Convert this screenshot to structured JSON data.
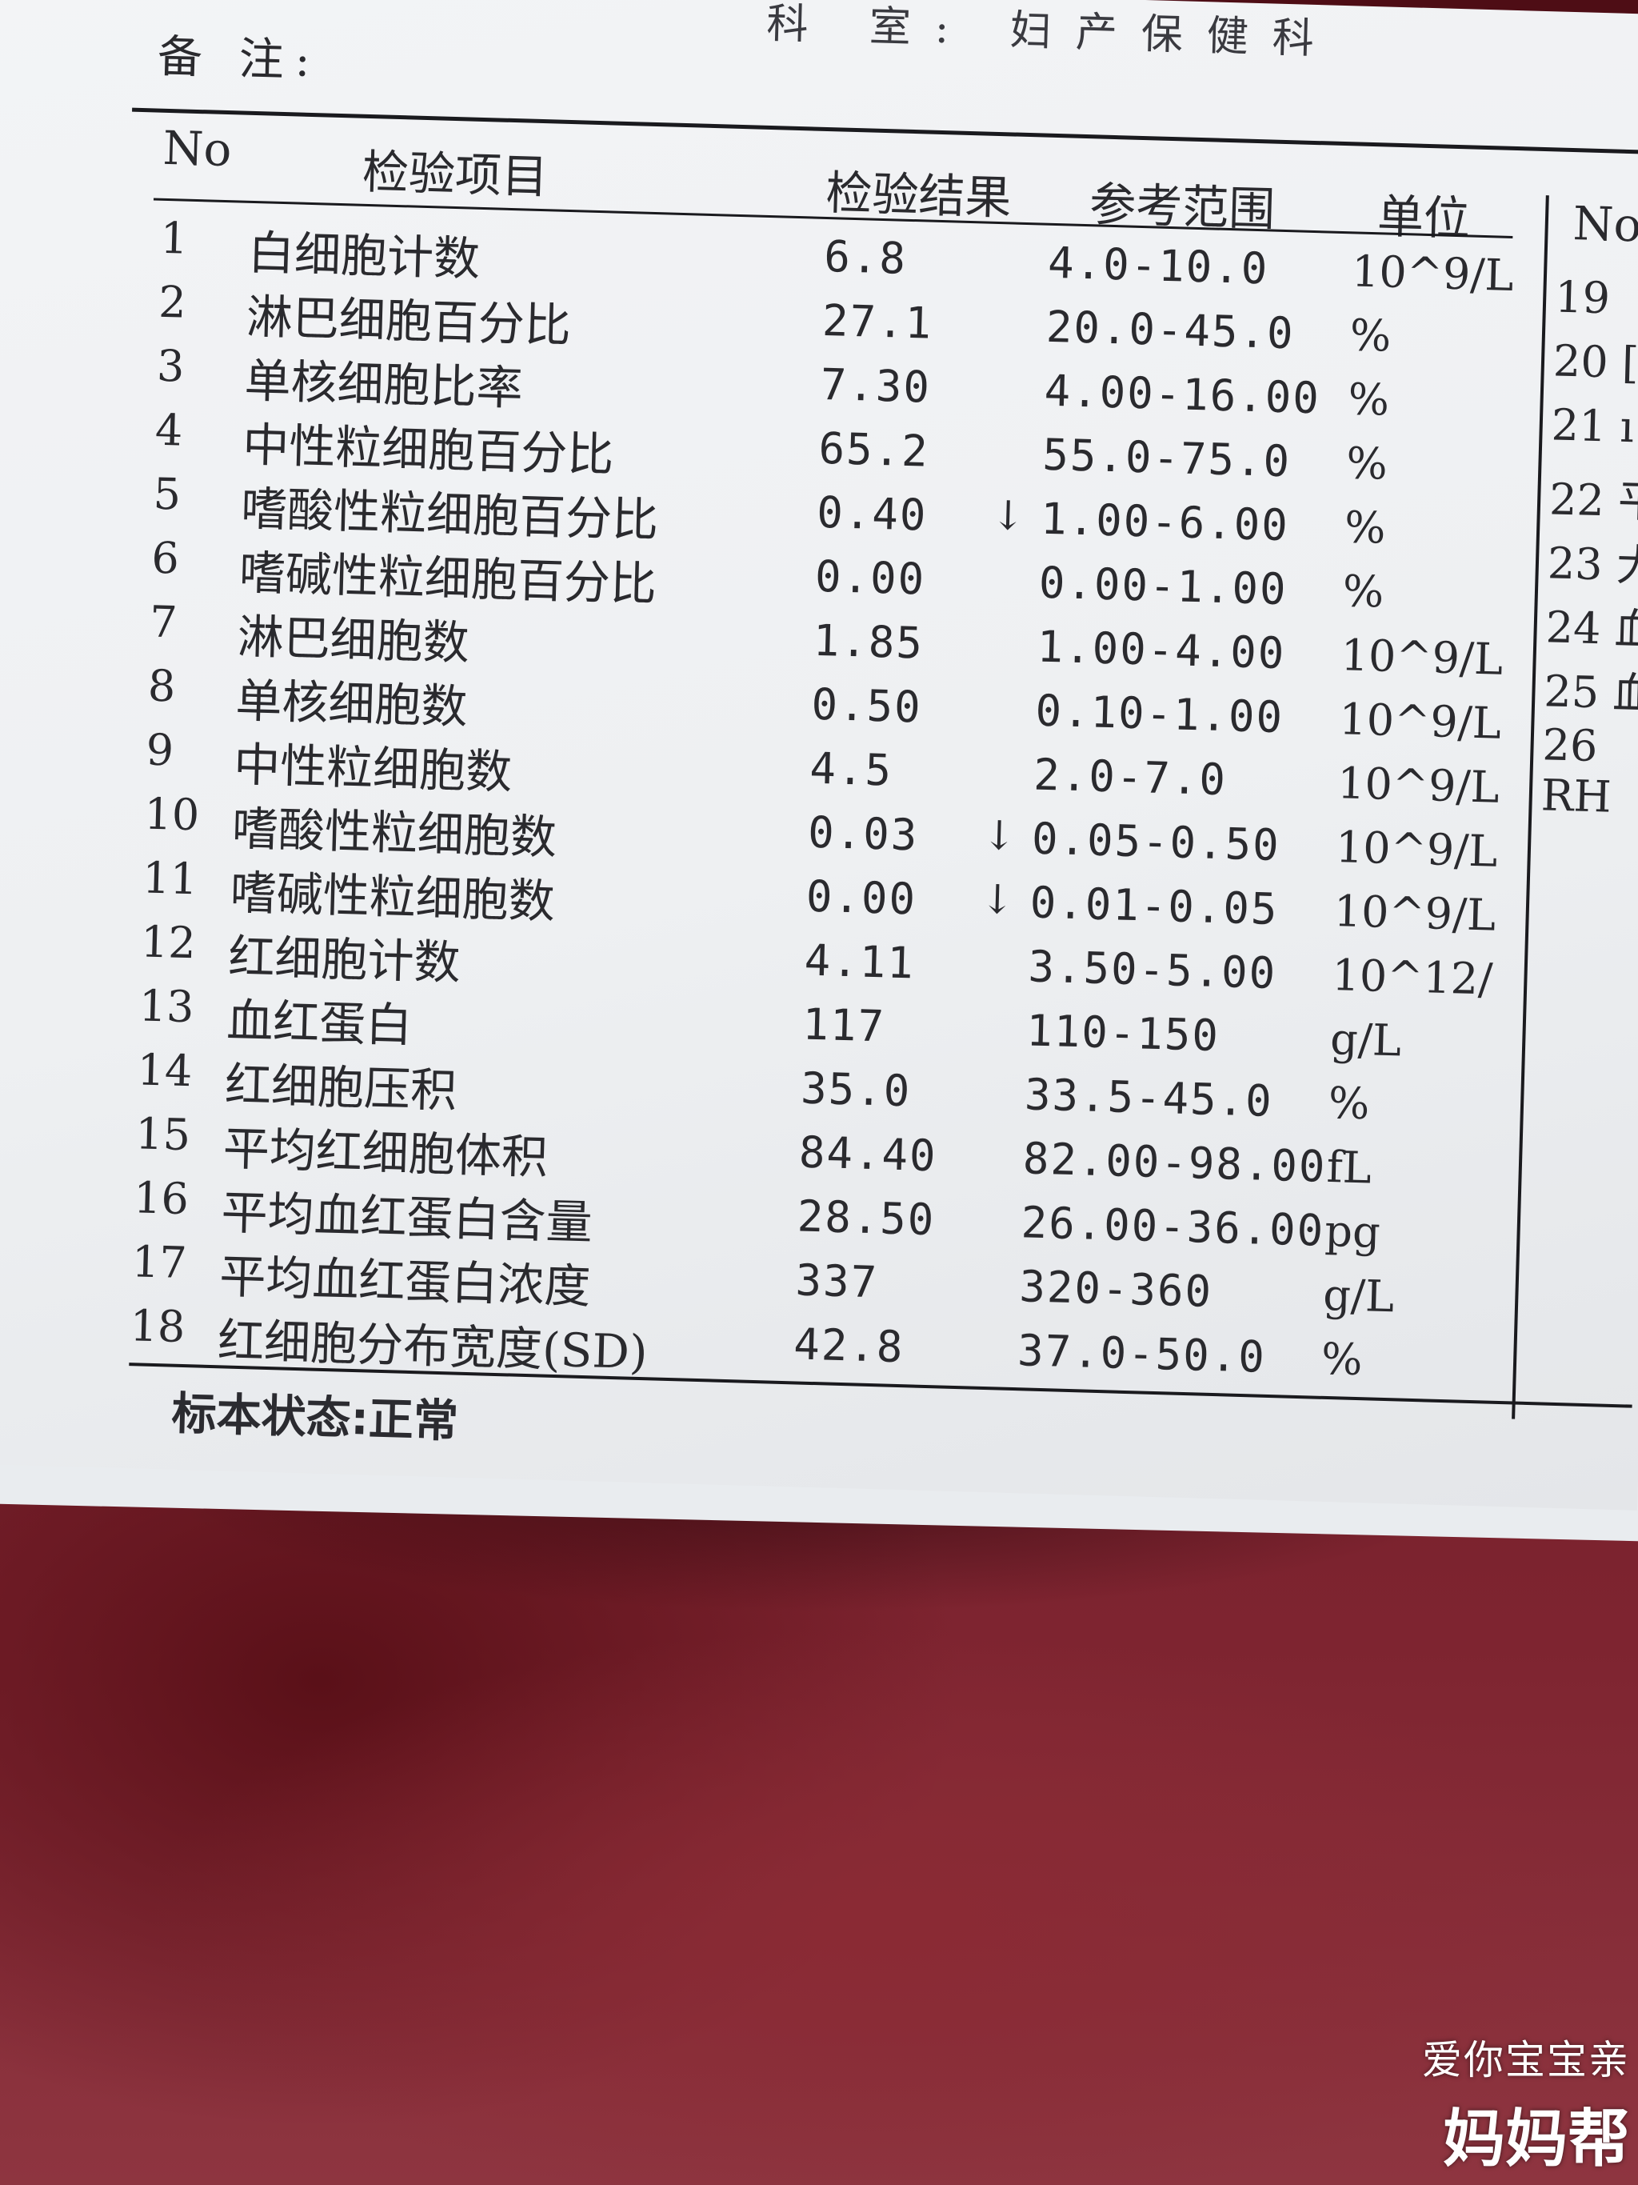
{
  "header": {
    "dept_fragment": "科 室: 妇产保健科",
    "remark_label": "备 注:"
  },
  "table": {
    "col_no": "No",
    "col_item": "检验项目",
    "col_result": "检验结果",
    "col_range": "参考范围",
    "col_unit": "单位",
    "rows": [
      {
        "no": "1",
        "name": "白细胞计数",
        "result": "6.8",
        "flag": "",
        "range": "4.0-10.0",
        "unit": "10^9/L"
      },
      {
        "no": "2",
        "name": "淋巴细胞百分比",
        "result": "27.1",
        "flag": "",
        "range": "20.0-45.0",
        "unit": "%"
      },
      {
        "no": "3",
        "name": "单核细胞比率",
        "result": "7.30",
        "flag": "",
        "range": "4.00-16.00",
        "unit": "%"
      },
      {
        "no": "4",
        "name": "中性粒细胞百分比",
        "result": "65.2",
        "flag": "",
        "range": "55.0-75.0",
        "unit": "%"
      },
      {
        "no": "5",
        "name": "嗜酸性粒细胞百分比",
        "result": "0.40",
        "flag": "↓",
        "range": "1.00-6.00",
        "unit": "%"
      },
      {
        "no": "6",
        "name": "嗜碱性粒细胞百分比",
        "result": "0.00",
        "flag": "",
        "range": "0.00-1.00",
        "unit": "%"
      },
      {
        "no": "7",
        "name": "淋巴细胞数",
        "result": "1.85",
        "flag": "",
        "range": "1.00-4.00",
        "unit": "10^9/L"
      },
      {
        "no": "8",
        "name": "单核细胞数",
        "result": "0.50",
        "flag": "",
        "range": "0.10-1.00",
        "unit": "10^9/L"
      },
      {
        "no": "9",
        "name": "中性粒细胞数",
        "result": "4.5",
        "flag": "",
        "range": "2.0-7.0",
        "unit": "10^9/L"
      },
      {
        "no": "10",
        "name": "嗜酸性粒细胞数",
        "result": "0.03",
        "flag": "↓",
        "range": "0.05-0.50",
        "unit": "10^9/L"
      },
      {
        "no": "11",
        "name": "嗜碱性粒细胞数",
        "result": "0.00",
        "flag": "↓",
        "range": "0.01-0.05",
        "unit": "10^9/L"
      },
      {
        "no": "12",
        "name": "红细胞计数",
        "result": "4.11",
        "flag": "",
        "range": "3.50-5.00",
        "unit": "10^12/"
      },
      {
        "no": "13",
        "name": "血红蛋白",
        "result": "117",
        "flag": "",
        "range": "110-150",
        "unit": "g/L"
      },
      {
        "no": "14",
        "name": "红细胞压积",
        "result": "35.0",
        "flag": "",
        "range": "33.5-45.0",
        "unit": "%"
      },
      {
        "no": "15",
        "name": "平均红细胞体积",
        "result": "84.40",
        "flag": "",
        "range": "82.00-98.00",
        "unit": "fL"
      },
      {
        "no": "16",
        "name": "平均血红蛋白含量",
        "result": "28.50",
        "flag": "",
        "range": "26.00-36.00",
        "unit": "pg"
      },
      {
        "no": "17",
        "name": "平均血红蛋白浓度",
        "result": "337",
        "flag": "",
        "range": "320-360",
        "unit": "g/L"
      },
      {
        "no": "18",
        "name": "红细胞分布宽度(SD)",
        "result": "42.8",
        "flag": "",
        "range": "37.0-50.0",
        "unit": "%"
      }
    ]
  },
  "side_column": {
    "col_no": "No",
    "rows": [
      "19",
      "20 [",
      "21 ı",
      "22 平",
      "23 大",
      "24 血",
      "25 血",
      "26 RH"
    ]
  },
  "footer": {
    "specimen_status": "标本状态:正常"
  },
  "watermark": {
    "line1": "爱你宝宝亲",
    "line2": "妈妈帮"
  }
}
